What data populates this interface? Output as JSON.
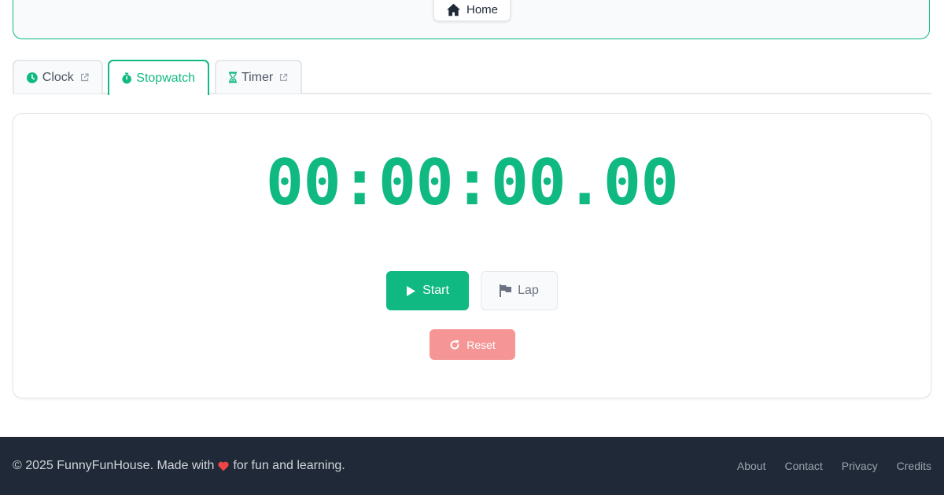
{
  "header": {
    "home_label": "Home"
  },
  "tabs": [
    {
      "label": "Clock",
      "icon": "clock-icon",
      "external": true
    },
    {
      "label": "Stopwatch",
      "icon": "stopwatch-icon",
      "active": true
    },
    {
      "label": "Timer",
      "icon": "hourglass-icon",
      "external": true
    }
  ],
  "stopwatch": {
    "display": "00:00:00.00",
    "start_label": "Start",
    "lap_label": "Lap",
    "reset_label": "Reset"
  },
  "footer": {
    "copyright_prefix": "© 2025 FunnyFunHouse. Made with",
    "copyright_suffix": "for fun and learning.",
    "links": [
      "About",
      "Contact",
      "Privacy",
      "Credits"
    ]
  },
  "colors": {
    "accent": "#10b981",
    "reset": "#f59595",
    "footer_bg": "#1f2937"
  }
}
